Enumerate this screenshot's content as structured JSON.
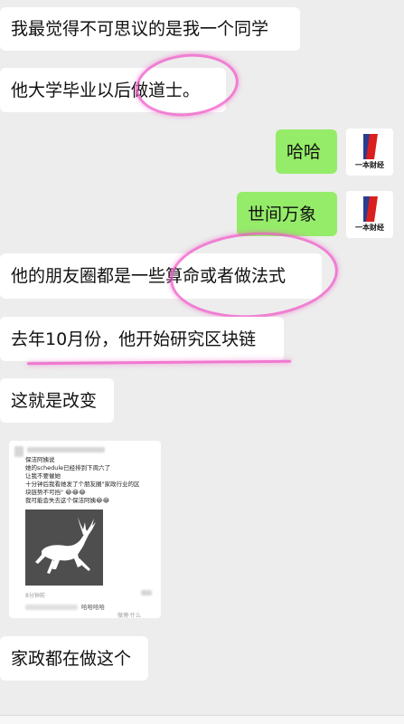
{
  "messages": [
    {
      "id": "m1",
      "side": "left",
      "text": "我最觉得不可思议的是我一个同学"
    },
    {
      "id": "m2",
      "side": "left",
      "text": "他大学毕业以后做道士。"
    },
    {
      "id": "m3",
      "side": "right",
      "text": "哈哈"
    },
    {
      "id": "m4",
      "side": "right",
      "text": "世间万象"
    },
    {
      "id": "m5",
      "side": "left",
      "text": "他的朋友圈都是一些算命或者做法式"
    },
    {
      "id": "m6",
      "side": "left",
      "text": "去年10月份，他开始研究区块链"
    },
    {
      "id": "m7",
      "side": "left",
      "text": "这就是改变"
    },
    {
      "id": "m8",
      "side": "left",
      "text": "家政都在做这个"
    }
  ],
  "avatar": {
    "logo_text": "一本财经",
    "colors": {
      "blue": "#2a3c8f",
      "red": "#d9201e"
    }
  },
  "screenshot_card": {
    "lines": [
      "保洁阿姨说",
      "她的schedule已经排到下周六了",
      "让我不要催她",
      "十分钟后我看她发了个朋友圈\"家政行业的区",
      "块链势不可挡\" 😂😂😂",
      "我可能会失去这个保洁阿姨😂😂"
    ],
    "time": "8分钟前",
    "comment": "哈哈哈哈",
    "watermark": "微博·什么"
  },
  "colors": {
    "bg": "#ededed",
    "left_bubble": "#ffffff",
    "right_bubble": "#95ec69",
    "highlight": "#f05ac8"
  }
}
